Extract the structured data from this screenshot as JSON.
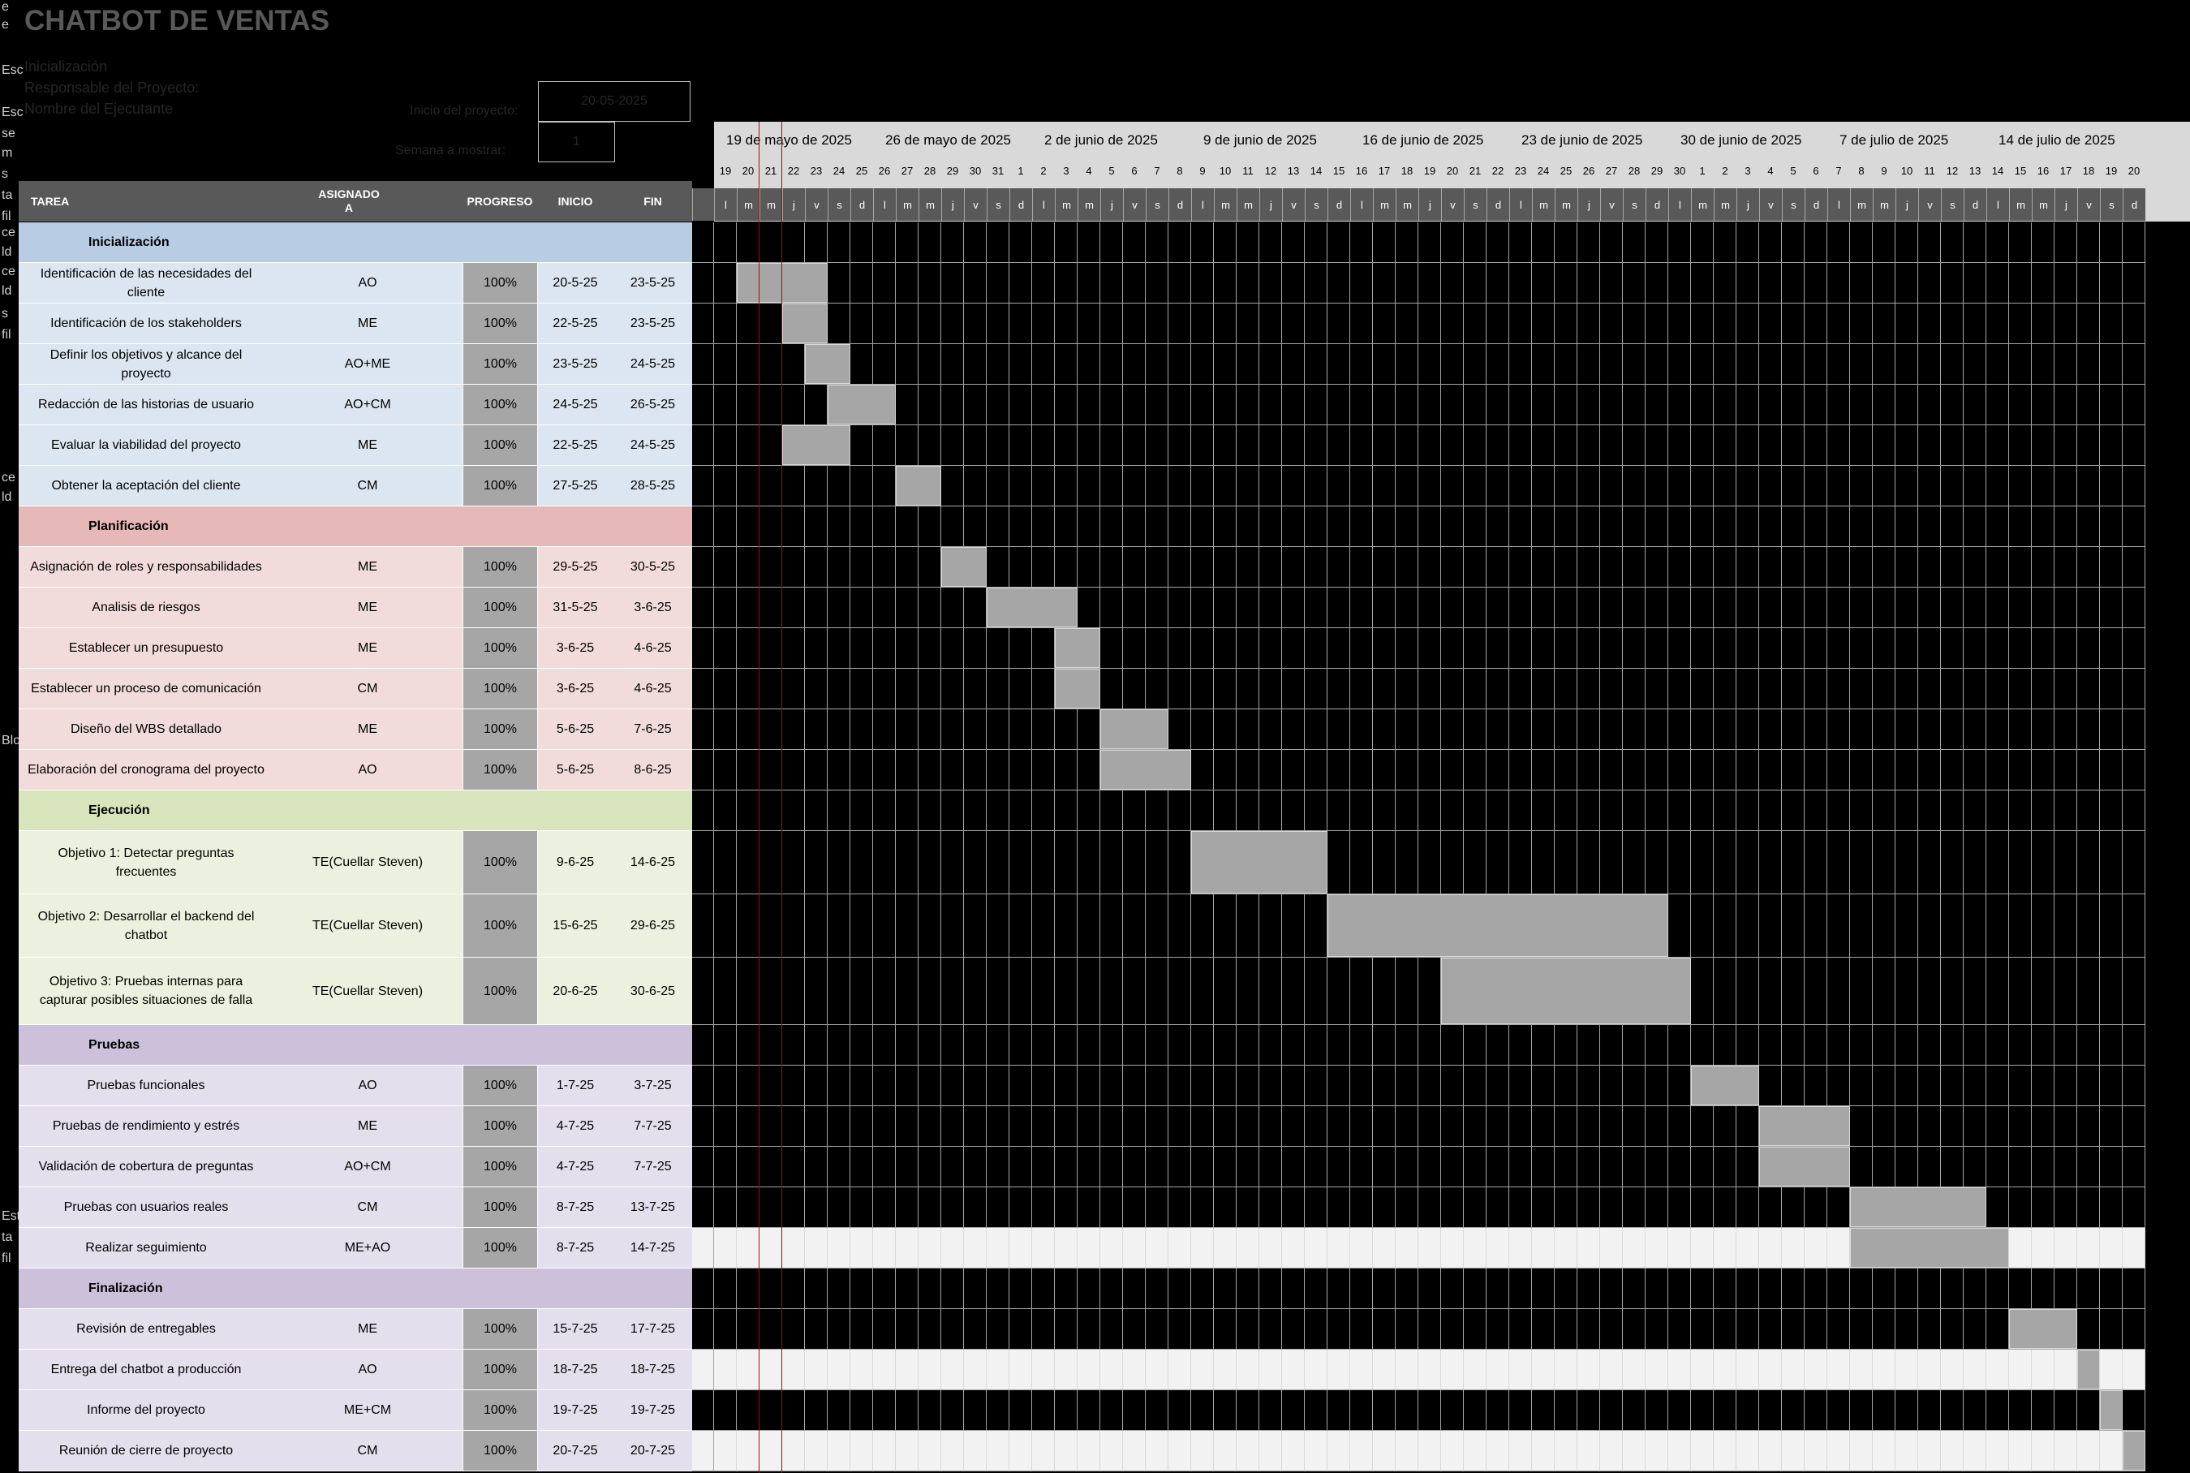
{
  "title": "CHATBOT DE VENTAS",
  "left_fragments": [
    "e",
    "e",
    "Esc",
    "Esc",
    "se",
    "m",
    "s",
    "ta",
    "fil",
    "ce",
    "ld",
    "ce",
    "ld",
    "s",
    "fil",
    "ce",
    "ld",
    "Blo",
    "Est",
    "ta",
    "fil"
  ],
  "meta": {
    "lines": [
      "Inicialización",
      "Responsable del Proyecto:",
      "Nombre del Ejecutante"
    ],
    "start_label": "Inicio del proyecto:",
    "start_value": "20-05-2025",
    "week_label": "Semana a mostrar:",
    "week_value": "1"
  },
  "columns": {
    "task": "TAREA",
    "assigned": "ASIGNADO\nA",
    "progress": "PROGRESO",
    "start": "INICIO",
    "end": "FIN"
  },
  "weeks": [
    "19 de mayo de 2025",
    "26 de mayo de 2025",
    "2 de junio de 2025",
    "9 de junio de 2025",
    "16 de junio de 2025",
    "23 de junio de 2025",
    "30 de junio de 2025",
    "7 de julio de 2025",
    "14 de julio de 2025"
  ],
  "day_numbers": [
    "19",
    "20",
    "21",
    "22",
    "23",
    "24",
    "25",
    "26",
    "27",
    "28",
    "29",
    "30",
    "31",
    "1",
    "2",
    "3",
    "4",
    "5",
    "6",
    "7",
    "8",
    "9",
    "10",
    "11",
    "12",
    "13",
    "14",
    "15",
    "16",
    "17",
    "18",
    "19",
    "20",
    "21",
    "22",
    "23",
    "24",
    "25",
    "26",
    "27",
    "28",
    "29",
    "30",
    "1",
    "2",
    "3",
    "4",
    "5",
    "6",
    "7",
    "8",
    "9",
    "10",
    "11",
    "12",
    "13",
    "14",
    "15",
    "16",
    "17",
    "18",
    "19",
    "20"
  ],
  "day_letters": [
    "l",
    "m",
    "m",
    "j",
    "v",
    "s",
    "d"
  ],
  "colors": {
    "phase1": "#b8cce4",
    "task1": "#dce6f1",
    "phase2": "#e6b8b7",
    "task2": "#f2dcdb",
    "phase3": "#d8e4bc",
    "task3": "#ebf1de",
    "phase4": "#ccc0da",
    "task4": "#e4dfec",
    "bar": "#a6a6a6",
    "today": "#c00000"
  },
  "rows": [
    {
      "kind": "phase",
      "group": 1,
      "task": "Inicialización"
    },
    {
      "kind": "task",
      "group": 1,
      "task": "Identificación de las necesidades del cliente",
      "assigned": "AO",
      "progress": "100%",
      "start": "20-5-25",
      "end": "23-5-25",
      "s": 1,
      "e": 4
    },
    {
      "kind": "task",
      "group": 1,
      "task": "Identificación de los stakeholders",
      "assigned": "ME",
      "progress": "100%",
      "start": "22-5-25",
      "end": "23-5-25",
      "s": 3,
      "e": 4
    },
    {
      "kind": "task",
      "group": 1,
      "task": "Definir los objetivos y alcance del proyecto",
      "assigned": "AO+ME",
      "progress": "100%",
      "start": "23-5-25",
      "end": "24-5-25",
      "s": 4,
      "e": 5
    },
    {
      "kind": "task",
      "group": 1,
      "task": "Redacción de las historias de usuario",
      "assigned": "AO+CM",
      "progress": "100%",
      "start": "24-5-25",
      "end": "26-5-25",
      "s": 5,
      "e": 7
    },
    {
      "kind": "task",
      "group": 1,
      "task": "Evaluar la viabilidad del proyecto",
      "assigned": "ME",
      "progress": "100%",
      "start": "22-5-25",
      "end": "24-5-25",
      "s": 3,
      "e": 5
    },
    {
      "kind": "task",
      "group": 1,
      "task": "Obtener la aceptación del cliente",
      "assigned": "CM",
      "progress": "100%",
      "start": "27-5-25",
      "end": "28-5-25",
      "s": 8,
      "e": 9
    },
    {
      "kind": "phase",
      "group": 2,
      "task": "Planificación"
    },
    {
      "kind": "task",
      "group": 2,
      "task": "Asignación de roles y responsabilidades",
      "assigned": "ME",
      "progress": "100%",
      "start": "29-5-25",
      "end": "30-5-25",
      "s": 10,
      "e": 11
    },
    {
      "kind": "task",
      "group": 2,
      "task": "Analisis de riesgos",
      "assigned": "ME",
      "progress": "100%",
      "start": "31-5-25",
      "end": "3-6-25",
      "s": 12,
      "e": 15
    },
    {
      "kind": "task",
      "group": 2,
      "task": "Establecer un presupuesto",
      "assigned": "ME",
      "progress": "100%",
      "start": "3-6-25",
      "end": "4-6-25",
      "s": 15,
      "e": 16
    },
    {
      "kind": "task",
      "group": 2,
      "task": "Establecer un proceso de comunicación",
      "assigned": "CM",
      "progress": "100%",
      "start": "3-6-25",
      "end": "4-6-25",
      "s": 15,
      "e": 16
    },
    {
      "kind": "task",
      "group": 2,
      "task": "Diseño del WBS detallado",
      "assigned": "ME",
      "progress": "100%",
      "start": "5-6-25",
      "end": "7-6-25",
      "s": 17,
      "e": 19
    },
    {
      "kind": "task",
      "group": 2,
      "task": "Elaboración del cronograma del proyecto",
      "assigned": "AO",
      "progress": "100%",
      "start": "5-6-25",
      "end": "8-6-25",
      "s": 17,
      "e": 20
    },
    {
      "kind": "phase",
      "group": 3,
      "task": "Ejecución"
    },
    {
      "kind": "task",
      "group": 3,
      "tall": true,
      "task": "Objetivo 1: Detectar preguntas frecuentes",
      "assigned": "TE(Cuellar Steven)",
      "progress": "100%",
      "start": "9-6-25",
      "end": "14-6-25",
      "s": 21,
      "e": 26
    },
    {
      "kind": "task",
      "group": 3,
      "tall": true,
      "task": "Objetivo 2: Desarrollar el backend del chatbot",
      "assigned": "TE(Cuellar Steven)",
      "progress": "100%",
      "start": "15-6-25",
      "end": "29-6-25",
      "s": 27,
      "e": 41
    },
    {
      "kind": "task",
      "group": 3,
      "taller": true,
      "task": "Objetivo 3: Pruebas internas para capturar posibles situaciones de falla",
      "assigned": "TE(Cuellar Steven)",
      "progress": "100%",
      "start": "20-6-25",
      "end": "30-6-25",
      "s": 32,
      "e": 42
    },
    {
      "kind": "phase",
      "group": 4,
      "task": "Pruebas"
    },
    {
      "kind": "task",
      "group": 4,
      "task": "Pruebas funcionales",
      "assigned": "AO",
      "progress": "100%",
      "start": "1-7-25",
      "end": "3-7-25",
      "s": 43,
      "e": 45
    },
    {
      "kind": "task",
      "group": 4,
      "task": "Pruebas de rendimiento y estrés",
      "assigned": "ME",
      "progress": "100%",
      "start": "4-7-25",
      "end": "7-7-25",
      "s": 46,
      "e": 49
    },
    {
      "kind": "task",
      "group": 4,
      "task": "Validación de cobertura de preguntas",
      "assigned": "AO+CM",
      "progress": "100%",
      "start": "4-7-25",
      "end": "7-7-25",
      "s": 46,
      "e": 49
    },
    {
      "kind": "task",
      "group": 4,
      "task": "Pruebas con usuarios reales",
      "assigned": "CM",
      "progress": "100%",
      "start": "8-7-25",
      "end": "13-7-25",
      "s": 50,
      "e": 55
    },
    {
      "kind": "task",
      "group": 4,
      "light": true,
      "task": "Realizar seguimiento",
      "assigned": "ME+AO",
      "progress": "100%",
      "start": "8-7-25",
      "end": "14-7-25",
      "s": 50,
      "e": 56
    },
    {
      "kind": "phase",
      "group": 4,
      "task": "Finalización"
    },
    {
      "kind": "task",
      "group": 4,
      "task": "Revisión de entregables",
      "assigned": "ME",
      "progress": "100%",
      "start": "15-7-25",
      "end": "17-7-25",
      "s": 57,
      "e": 59
    },
    {
      "kind": "task",
      "group": 4,
      "light": true,
      "task": "Entrega del chatbot a producción",
      "assigned": "AO",
      "progress": "100%",
      "start": "18-7-25",
      "end": "18-7-25",
      "s": 60,
      "e": 60
    },
    {
      "kind": "task",
      "group": 4,
      "task": "Informe del proyecto",
      "assigned": "ME+CM",
      "progress": "100%",
      "start": "19-7-25",
      "end": "19-7-25",
      "s": 61,
      "e": 61
    },
    {
      "kind": "task",
      "group": 4,
      "light": true,
      "task": "Reunión de cierre de proyecto",
      "assigned": "CM",
      "progress": "100%",
      "start": "20-7-25",
      "end": "20-7-25",
      "s": 62,
      "e": 62
    }
  ]
}
